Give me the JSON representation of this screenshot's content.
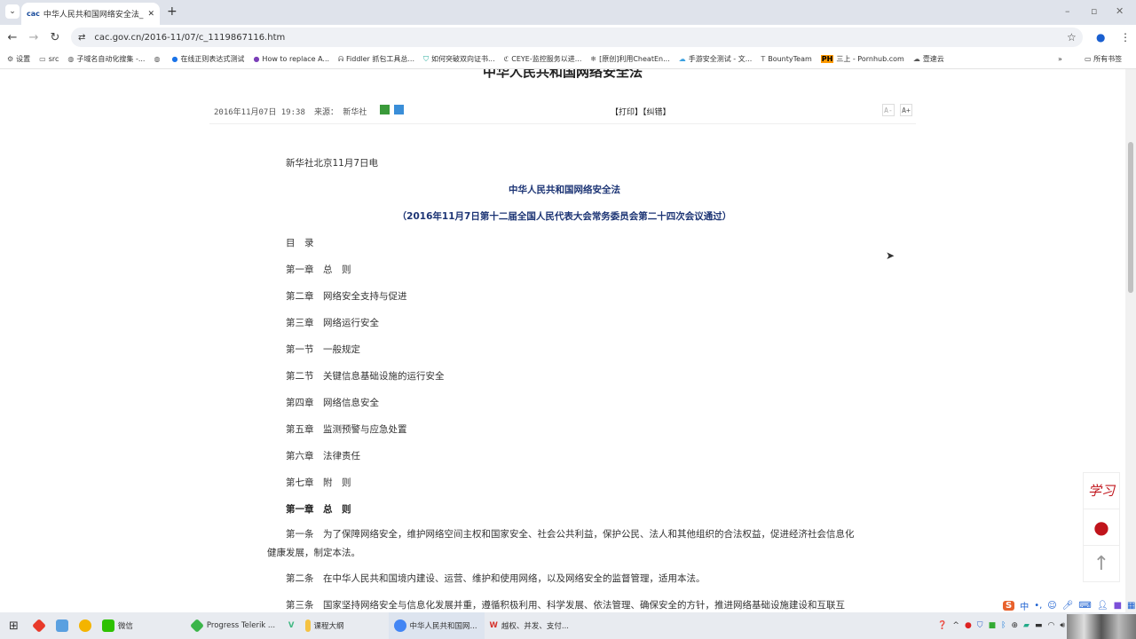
{
  "browser": {
    "tab_title": "中华人民共和国网络安全法_中",
    "tab_favicon": "cac",
    "url": "cac.gov.cn/2016-11/07/c_1119867116.htm",
    "bookmarks": [
      "设置",
      "src",
      "子域名自动化搜集 -...",
      "",
      "在线正则表达式测试",
      "How to replace A...",
      "Fiddler 抓包工具总...",
      "如何突破双向证书...",
      "CEYE-监控服务以进...",
      "[原创]利用CheatEn...",
      "手游安全测试 - 文...",
      "BountyTeam",
      "三上 - Pornhub.com",
      "壹速云"
    ],
    "bookmarks_more": "»",
    "all_bookmarks": "所有书签"
  },
  "article": {
    "title": "中华人民共和国网络安全法",
    "date": "2016年11月07日 19:38",
    "source": "来源： 新华社",
    "print_links": "【打印】【纠错】",
    "font_smaller": "A-",
    "font_larger": "A+",
    "dateline": "新华社北京11月7日电",
    "law_title": "中华人民共和国网络安全法",
    "law_subtitle": "（2016年11月7日第十二届全国人民代表大会常务委员会第二十四次会议通过）",
    "toc": [
      "目　录",
      "第一章　总　则",
      "第二章　网络安全支持与促进",
      "第三章　网络运行安全",
      "第一节　一般规定",
      "第二节　关键信息基础设施的运行安全",
      "第四章　网络信息安全",
      "第五章　监测预警与应急处置",
      "第六章　法律责任",
      "第七章　附　则"
    ],
    "chapter1": "第一章　总　则",
    "articles": [
      "第一条　为了保障网络安全，维护网络空间主权和国家安全、社会公共利益，保护公民、法人和其他组织的合法权益，促进经济社会信息化健康发展，制定本法。",
      "第二条　在中华人民共和国境内建设、运营、维护和使用网络，以及网络安全的监督管理，适用本法。",
      "第三条　国家坚持网络安全与信息化发展并重，遵循积极利用、科学发展、依法管理、确保安全的方针，推进网络基础设施建设和互联互"
    ]
  },
  "side": {
    "xuexi": "学习"
  },
  "ime": {
    "lang": "中"
  },
  "taskbar": [
    {
      "label": "微信",
      "color": "#2dc100"
    },
    {
      "label": "Progress Telerik ...",
      "color": "#3bb54a"
    },
    {
      "label": "课程大纲",
      "color": "#f5c242"
    },
    {
      "label": "中华人民共和国网...",
      "color": "#4285f4"
    },
    {
      "label": "越权、并发、支付...",
      "color": "#d6332c"
    }
  ]
}
